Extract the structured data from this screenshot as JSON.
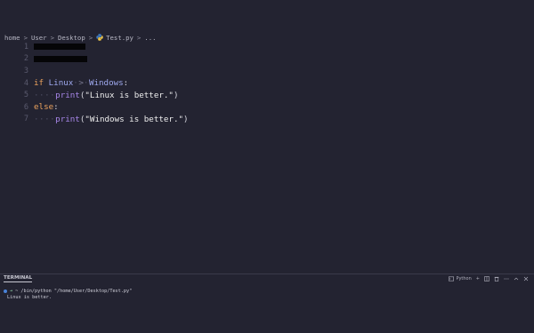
{
  "breadcrumb": {
    "items": [
      "home",
      "User",
      "Desktop"
    ],
    "file_label": "Test.py",
    "tail": "...",
    "separator": ">"
  },
  "editor": {
    "lines": [
      {
        "number": "1"
      },
      {
        "number": "2"
      },
      {
        "number": "3"
      },
      {
        "number": "4",
        "kw": "if",
        "left": "Linux",
        "op": ">",
        "right": "Windows",
        "colon": ":"
      },
      {
        "number": "5",
        "dots": "···",
        "fn": "print",
        "open": "(",
        "str": "\"Linux is better.\"",
        "close": ")"
      },
      {
        "number": "6",
        "kw": "else",
        "colon": ":"
      },
      {
        "number": "7",
        "dots": "···",
        "fn": "print",
        "open": "(",
        "str": "\"Windows is better.\"",
        "close": ")"
      }
    ]
  },
  "panel": {
    "tab_label": "TERMINAL",
    "shell_label": "Python",
    "plus_label": "+"
  },
  "terminal": {
    "prompt_glyph": "~",
    "command": "/bin/python \"/home/User/Desktop/Test.py\"",
    "output": "Linux is better."
  },
  "colors": {
    "background": "#232331",
    "keyword": "#eba25d",
    "variable": "#9ea8ee",
    "function": "#a786e8",
    "string": "#eeeeee"
  },
  "icons": {
    "file_icon": "python-file-icon",
    "terminal_dot": "terminal-status-dot",
    "panel_actions": [
      "terminal-icon",
      "plus-icon",
      "split-icon",
      "trash-icon",
      "more-icon",
      "maximize-icon",
      "close-icon"
    ]
  }
}
